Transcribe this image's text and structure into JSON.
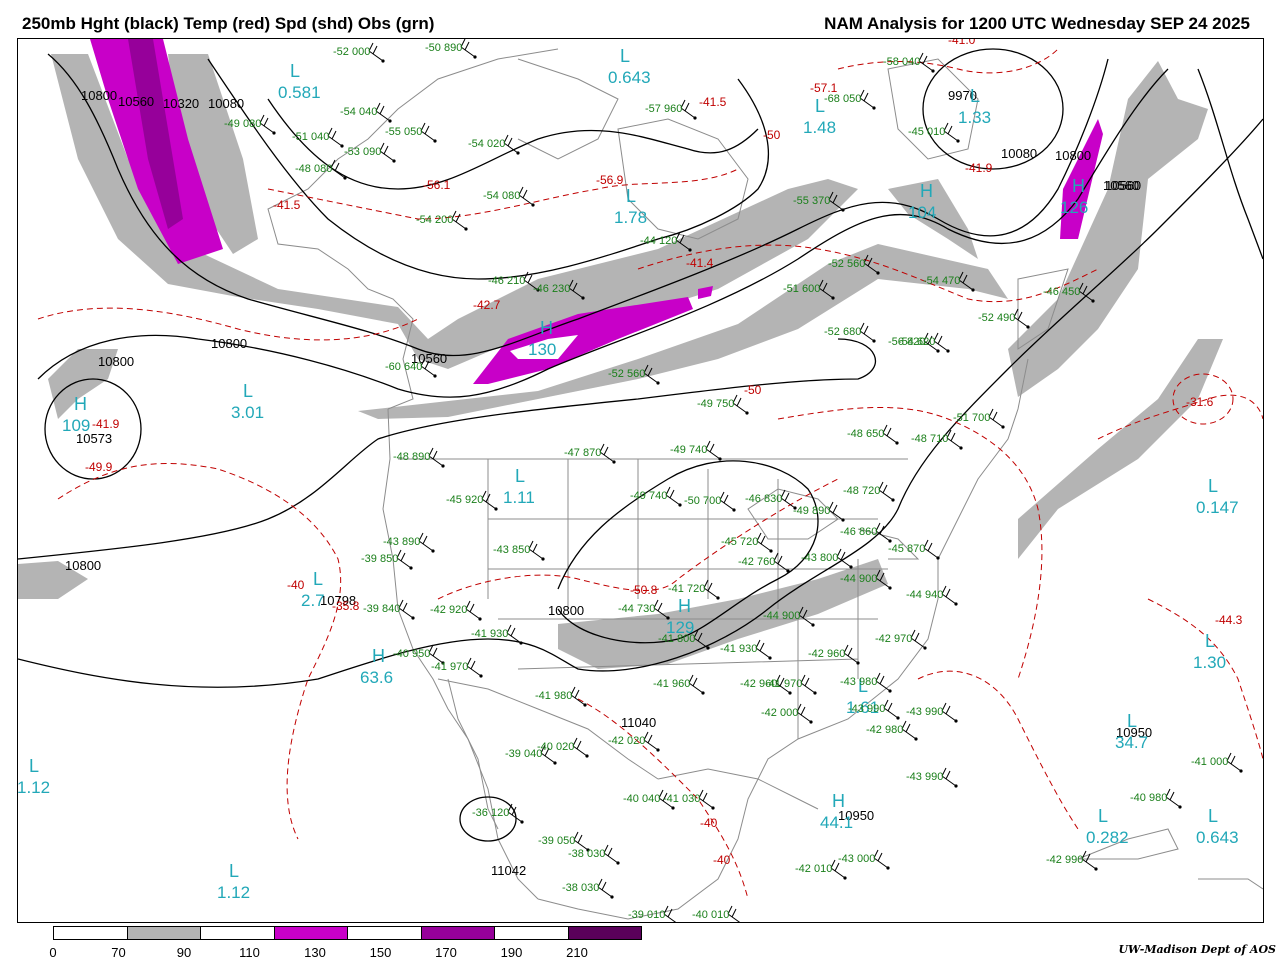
{
  "header": {
    "left_title": "250mb Hght (black) Temp (red) Spd (shd) Obs (grn)",
    "right_title": "NAM Analysis for 1200 UTC Wednesday  SEP 24 2025"
  },
  "legend": {
    "ticks": [
      "0",
      "70",
      "90",
      "110",
      "130",
      "150",
      "170",
      "190",
      "210"
    ],
    "colors": [
      "#ffffff",
      "#b4b4b4",
      "#ffffff",
      "#c800c8",
      "#ffffff",
      "#96009a",
      "#ffffff",
      "#5a005a"
    ]
  },
  "credit": "UW-Madison  Dept of AOS",
  "colors": {
    "height_contour": "#000000",
    "temperature_contour": "#c00000",
    "observations": "#1a7f1a",
    "speed_center_label": "#22a8b8",
    "map_lines": "#8c8c8c"
  },
  "height_labels": [
    "10800",
    "10560",
    "10320",
    "10080",
    "10800",
    "10800",
    "10800",
    "10573",
    "10800",
    "10798",
    "10800",
    "10560",
    "10080",
    "9970",
    "10560",
    "10560",
    "11040",
    "10950",
    "10950",
    "11042"
  ],
  "temp_labels": [
    "-41.5",
    "-56.1",
    "-56.9",
    "-41.5",
    "-41.4",
    "-42.7",
    "-41.9",
    "-49.9",
    "-40",
    "-35.8",
    "-50.8",
    "-50",
    "-41.9",
    "-31.6",
    "-44.3",
    "-40",
    "-40",
    "-57.1",
    "-50",
    "-41.0"
  ],
  "speed_centers": [
    {
      "type": "L",
      "value": "0.581"
    },
    {
      "type": "L",
      "value": "0.643"
    },
    {
      "type": "L",
      "value": "1.48"
    },
    {
      "type": "L",
      "value": "1.33"
    },
    {
      "type": "L",
      "value": "1.78"
    },
    {
      "type": "H",
      "value": "104"
    },
    {
      "type": "H",
      "value": "130"
    },
    {
      "type": "L",
      "value": "3.01"
    },
    {
      "type": "H",
      "value": "109"
    },
    {
      "type": "L",
      "value": "1.11"
    },
    {
      "type": "L",
      "value": "2.7"
    },
    {
      "type": "H",
      "value": "63.6"
    },
    {
      "type": "H",
      "value": "129"
    },
    {
      "type": "L",
      "value": "1.61"
    },
    {
      "type": "L",
      "value": "0.147"
    },
    {
      "type": "L",
      "value": "1.30"
    },
    {
      "type": "L",
      "value": "34.7"
    },
    {
      "type": "H",
      "value": "44.1"
    },
    {
      "type": "L",
      "value": "0.282"
    },
    {
      "type": "L",
      "value": "0.643"
    },
    {
      "type": "L",
      "value": "1.12"
    },
    {
      "type": "L",
      "value": "1.12"
    },
    {
      "type": "H",
      "value": "126"
    }
  ],
  "observations": [
    "-52 000",
    "-50 890",
    "-54 040",
    "-49 080",
    "-55 050",
    "-51 040",
    "-53 090",
    "-54 020",
    "-48 080",
    "-54 080",
    "-54 200",
    "-57 960",
    "-55 370",
    "-44 120",
    "-52 560",
    "-54 470",
    "-46 210",
    "-46 230",
    "-51 600",
    "-52 680",
    "-46 450",
    "-52 490",
    "-54 620",
    "-56 820",
    "-58 040",
    "-45 010",
    "-68 050",
    "-60 640",
    "-49 750",
    "-52 560",
    "-51 700",
    "-48 890",
    "-47 870",
    "-49 740",
    "-48 650",
    "-48 710",
    "-45 920",
    "-49 740",
    "-50 700",
    "-46 830",
    "-49 890",
    "-48 720",
    "-46 860",
    "-43 890",
    "-43 850",
    "-39 850",
    "-45 720",
    "-42 760",
    "-43 800",
    "-44 900",
    "-45 870",
    "-39 840",
    "-42 920",
    "-41 930",
    "-41 720",
    "-44 730",
    "-41 800",
    "-44 900",
    "-44 940",
    "-40 950",
    "-41 970",
    "-42 960",
    "-42 970",
    "-41 980",
    "-41 960",
    "-41 930",
    "-42 960",
    "-41 970",
    "-43 980",
    "-43 990",
    "-39 040",
    "-40 020",
    "-42 020",
    "-42 000",
    "-42 980",
    "-43 990",
    "-43 990",
    "-41 000",
    "-40 980",
    "-36 120",
    "-40 040",
    "-41 030",
    "-39 050",
    "-38 030",
    "-38 030",
    "-42 010",
    "-43 000",
    "-42 990",
    "-39 010",
    "-40 010"
  ]
}
